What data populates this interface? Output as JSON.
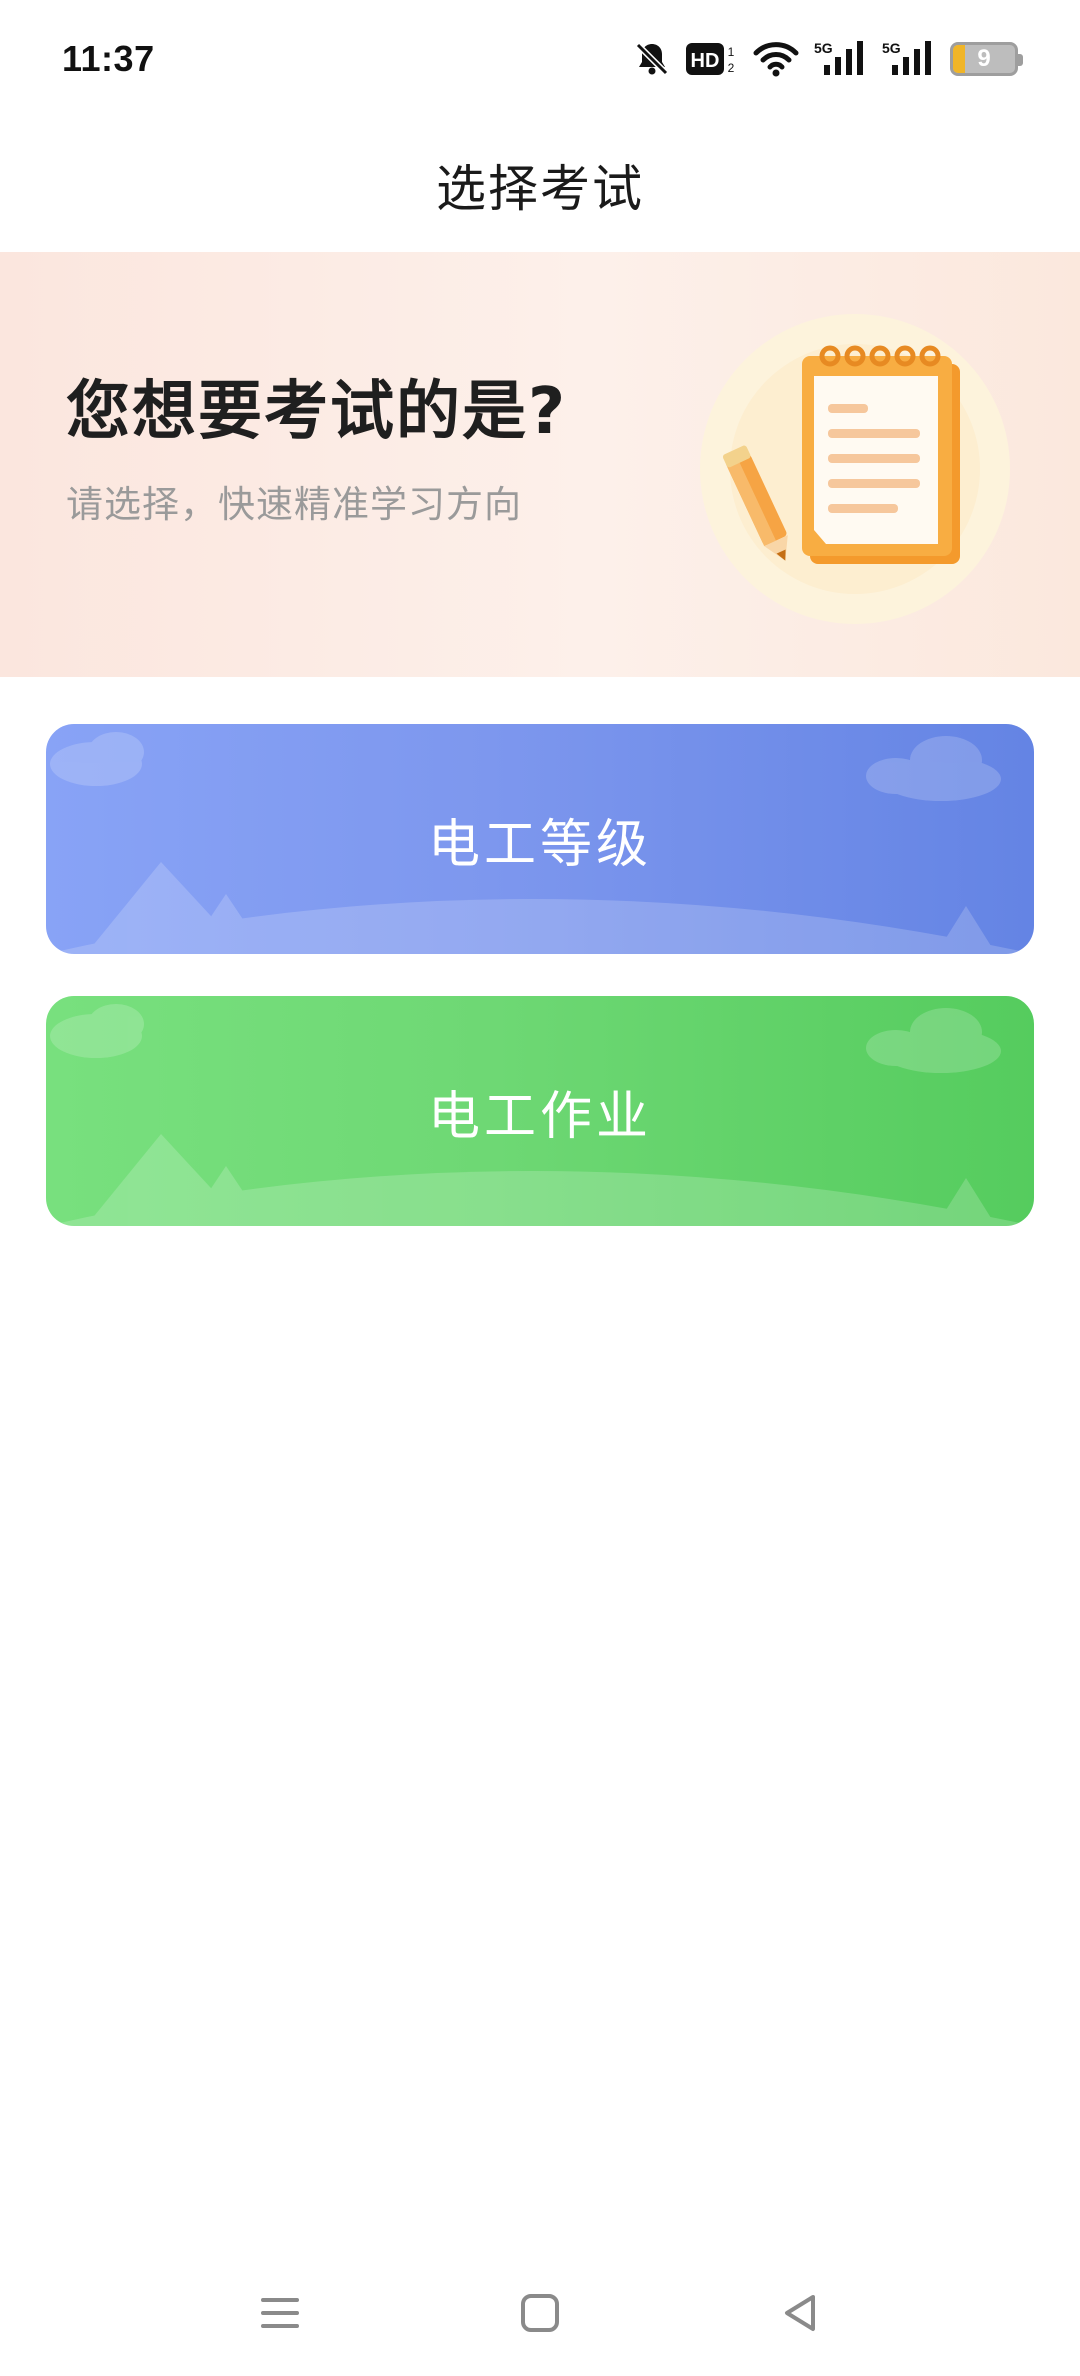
{
  "status_bar": {
    "time": "11:37",
    "battery_level": "9",
    "network_1": "5G",
    "network_2": "5G",
    "hd_badge": "HD",
    "icons": [
      "bell-off-icon",
      "hd-icon",
      "wifi-icon",
      "signal-icon",
      "signal-icon",
      "battery-icon"
    ]
  },
  "header": {
    "title": "选择考试"
  },
  "hero": {
    "title": "您想要考试的是?",
    "subtitle": "请选择，快速精准学习方向",
    "illustration": "notepad-pencil-illustration"
  },
  "exams": [
    {
      "label": "电工等级",
      "color": "#7d97ee"
    },
    {
      "label": "电工作业",
      "color": "#6ed874"
    }
  ],
  "nav": {
    "icons": [
      "menu-icon",
      "home-icon",
      "back-icon"
    ]
  },
  "colors": {
    "hero_bg": "#fdf0ea",
    "accent_orange": "#f7a23a",
    "card_blue": "#7d97ee",
    "card_green": "#6ed874"
  }
}
